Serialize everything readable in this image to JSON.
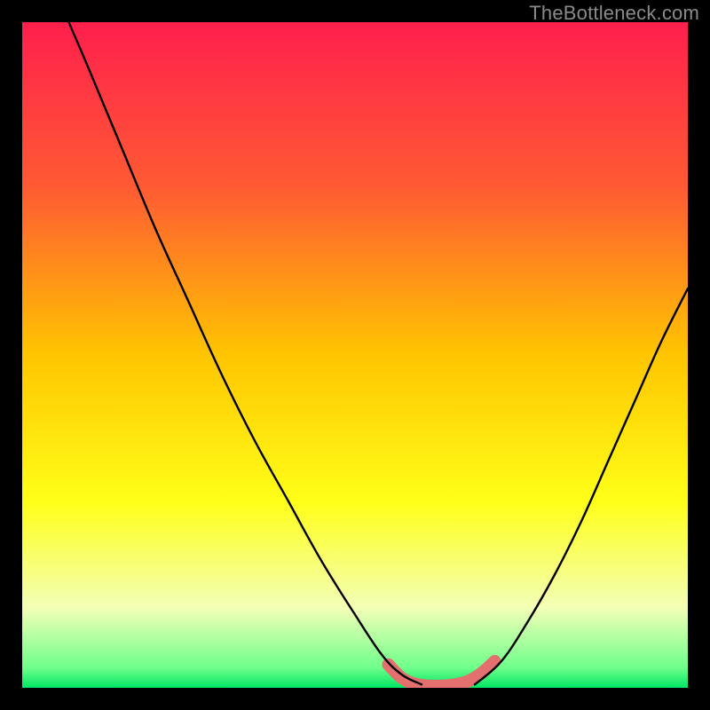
{
  "watermark": "TheBottleneck.com",
  "chart_data": {
    "type": "line",
    "title": "",
    "xlabel": "",
    "ylabel": "",
    "xlim": [
      0,
      100
    ],
    "ylim": [
      0,
      100
    ],
    "series": [
      {
        "name": "left-curve",
        "x": [
          7,
          10,
          15,
          20,
          25,
          30,
          35,
          40,
          45,
          50,
          54,
          57,
          60
        ],
        "y": [
          100,
          93,
          81,
          69,
          58,
          47,
          37,
          28,
          19,
          11,
          5,
          2,
          0.5
        ]
      },
      {
        "name": "right-curve",
        "x": [
          68,
          72,
          76,
          80,
          84,
          88,
          92,
          96,
          100
        ],
        "y": [
          0.5,
          4,
          10,
          17,
          25,
          34,
          43,
          52,
          60
        ]
      },
      {
        "name": "trough-highlight",
        "x": [
          55,
          57,
          59,
          61,
          63,
          65,
          67,
          69,
          71
        ],
        "y": [
          3.5,
          1.5,
          0.6,
          0.3,
          0.3,
          0.5,
          1.0,
          2.2,
          4.0
        ]
      }
    ],
    "gradient_stops": [
      {
        "pos": 0.0,
        "color": "#ff1f4d"
      },
      {
        "pos": 0.25,
        "color": "#ff5b33"
      },
      {
        "pos": 0.5,
        "color": "#ffc500"
      },
      {
        "pos": 0.72,
        "color": "#ffff18"
      },
      {
        "pos": 0.88,
        "color": "#f3ffb7"
      },
      {
        "pos": 0.97,
        "color": "#6fff8a"
      },
      {
        "pos": 1.0,
        "color": "#00e565"
      }
    ],
    "highlight_color": "#e46f6f",
    "curve_color": "#000000"
  }
}
